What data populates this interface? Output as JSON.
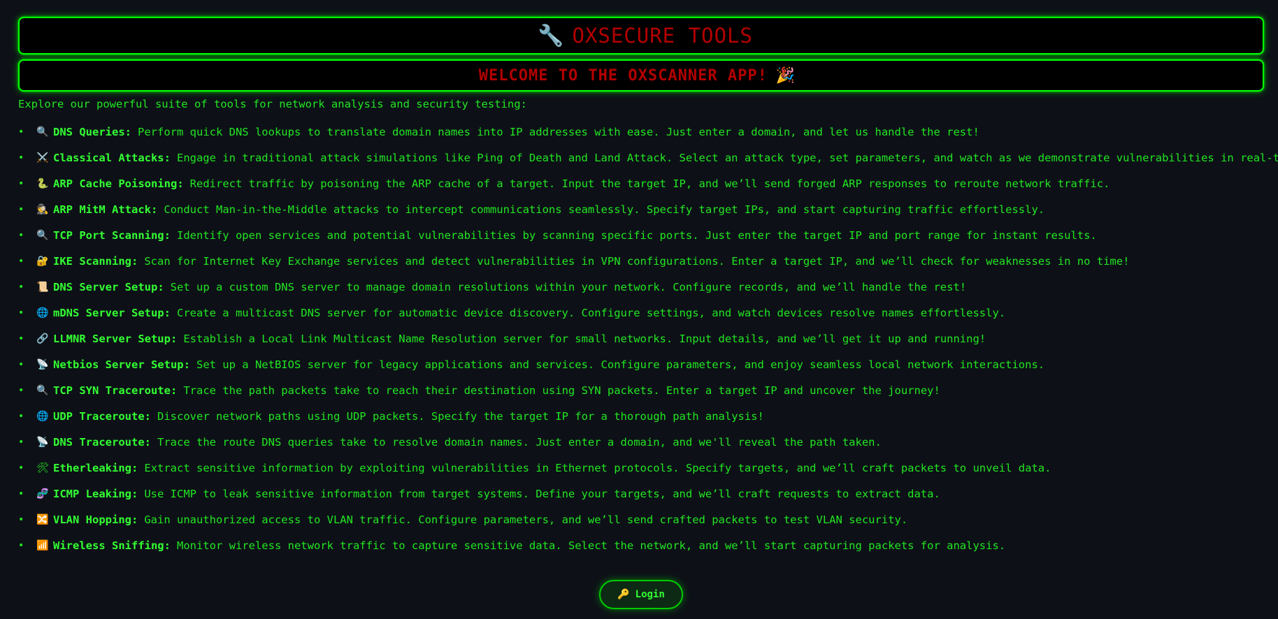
{
  "header": {
    "title_emoji": "🔧",
    "title": "OXSECURE TOOLS",
    "welcome": "WELCOME TO THE OXSCANNER APP!",
    "welcome_emoji": "🎉"
  },
  "intro": "Explore our powerful suite of tools for network analysis and security testing:",
  "bullet": "•",
  "tools": [
    {
      "icon": "🔍",
      "name": "DNS Queries",
      "desc": "Perform quick DNS lookups to translate domain names into IP addresses with ease. Just enter a domain, and let us handle the rest!"
    },
    {
      "icon": "⚔️",
      "name": "Classical Attacks",
      "desc": "Engage in traditional attack simulations like Ping of Death and Land Attack. Select an attack type, set parameters, and watch as we demonstrate vulnerabilities in real-time!"
    },
    {
      "icon": "🐍",
      "name": "ARP Cache Poisoning",
      "desc": "Redirect traffic by poisoning the ARP cache of a target. Input the target IP, and we’ll send forged ARP responses to reroute network traffic."
    },
    {
      "icon": "🕵️",
      "name": "ARP MitM Attack",
      "desc": "Conduct Man-in-the-Middle attacks to intercept communications seamlessly. Specify target IPs, and start capturing traffic effortlessly."
    },
    {
      "icon": "🔍",
      "name": "TCP Port Scanning",
      "desc": "Identify open services and potential vulnerabilities by scanning specific ports. Just enter the target IP and port range for instant results."
    },
    {
      "icon": "🔐",
      "name": "IKE Scanning",
      "desc": "Scan for Internet Key Exchange services and detect vulnerabilities in VPN configurations. Enter a target IP, and we’ll check for weaknesses in no time!"
    },
    {
      "icon": "📜",
      "name": "DNS Server Setup",
      "desc": "Set up a custom DNS server to manage domain resolutions within your network. Configure records, and we’ll handle the rest!"
    },
    {
      "icon": "🌐",
      "name": "mDNS Server Setup",
      "desc": "Create a multicast DNS server for automatic device discovery. Configure settings, and watch devices resolve names effortlessly."
    },
    {
      "icon": "🔗",
      "name": "LLMNR Server Setup",
      "desc": "Establish a Local Link Multicast Name Resolution server for small networks. Input details, and we’ll get it up and running!"
    },
    {
      "icon": "📡",
      "name": "Netbios Server Setup",
      "desc": "Set up a NetBIOS server for legacy applications and services. Configure parameters, and enjoy seamless local network interactions."
    },
    {
      "icon": "🔍",
      "name": "TCP SYN Traceroute",
      "desc": "Trace the path packets take to reach their destination using SYN packets. Enter a target IP and uncover the journey!"
    },
    {
      "icon": "🌐",
      "name": "UDP Traceroute",
      "desc": "Discover network paths using UDP packets. Specify the target IP for a thorough path analysis!"
    },
    {
      "icon": "📡",
      "name": "DNS Traceroute",
      "desc": "Trace the route DNS queries take to resolve domain names. Just enter a domain, and we'll reveal the path taken."
    },
    {
      "icon": "🛠",
      "name": "Etherleaking",
      "desc": "Extract sensitive information by exploiting vulnerabilities in Ethernet protocols. Specify targets, and we’ll craft packets to unveil data."
    },
    {
      "icon": "🧬",
      "name": "ICMP Leaking",
      "desc": "Use ICMP to leak sensitive information from target systems. Define your targets, and we’ll craft requests to extract data."
    },
    {
      "icon": "🔀",
      "name": "VLAN Hopping",
      "desc": "Gain unauthorized access to VLAN traffic. Configure parameters, and we’ll send crafted packets to test VLAN security."
    },
    {
      "icon": "📶",
      "name": "Wireless Sniffing",
      "desc": "Monitor wireless network traffic to capture sensitive data. Select the network, and we’ll start capturing packets for analysis."
    }
  ],
  "login": {
    "icon": "🔑",
    "label": "Login"
  },
  "colors": {
    "background": "#0d1117",
    "accent": "#00ff00",
    "title_red": "#b30000"
  }
}
